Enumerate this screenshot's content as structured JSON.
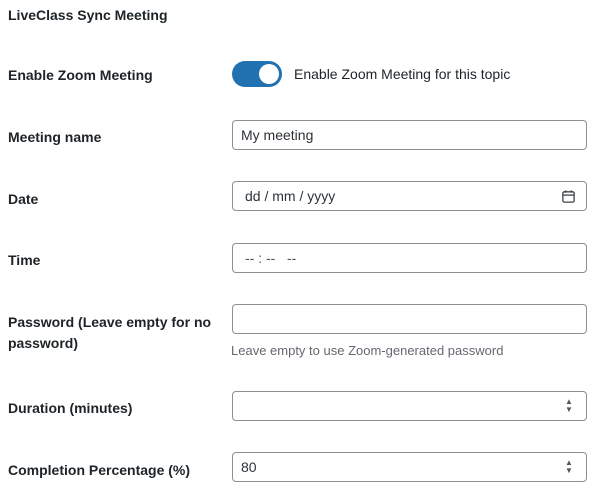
{
  "section": {
    "title": "LiveClass Sync Meeting"
  },
  "enable_zoom": {
    "label": "Enable Zoom Meeting",
    "toggle_on": true,
    "toggle_text": "Enable Zoom Meeting for this topic"
  },
  "meeting_name": {
    "label": "Meeting name",
    "value": "My meeting"
  },
  "date": {
    "label": "Date",
    "placeholder": "dd / mm / yyyy",
    "icon": "calendar-icon"
  },
  "time": {
    "label": "Time",
    "placeholder": "-- : --   --"
  },
  "password": {
    "label": "Password (Leave empty for no password)",
    "value": "",
    "help": "Leave empty to use Zoom-generated password"
  },
  "duration": {
    "label": "Duration (minutes)",
    "value": ""
  },
  "completion": {
    "label": "Completion Percentage (%)",
    "value": "80"
  },
  "colors": {
    "accent": "#2271b1",
    "border": "#8c8f94",
    "help_text": "#646970"
  }
}
